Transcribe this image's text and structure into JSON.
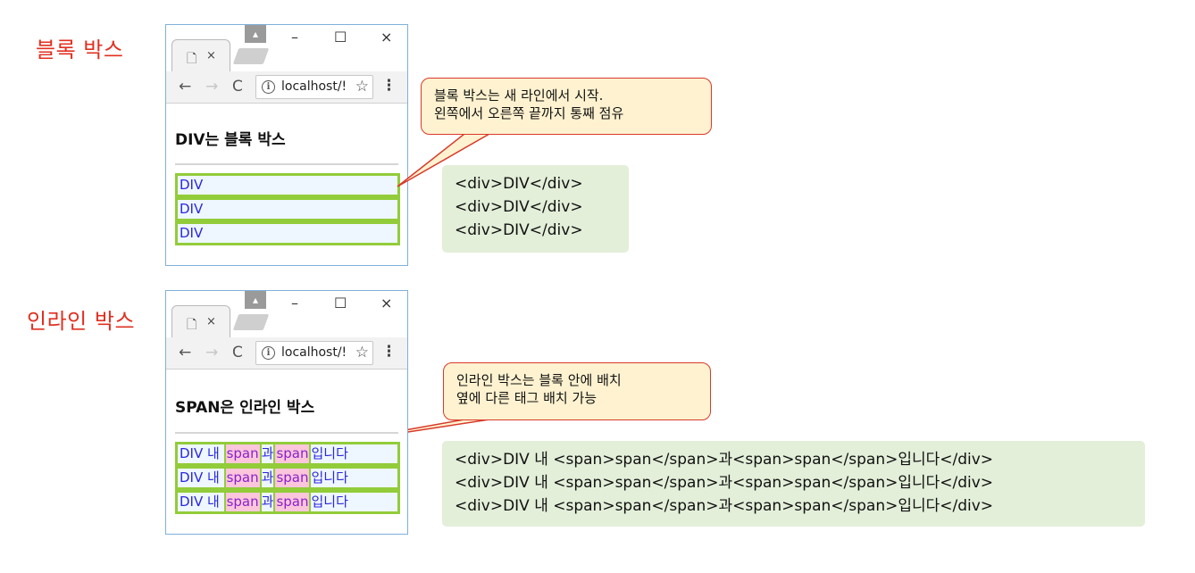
{
  "sections": [
    {
      "label": "블록 박스",
      "browser": {
        "tab_doc_icon": "document-icon",
        "tab_close": "×",
        "win_min": "–",
        "win_max": "☐",
        "win_close": "×",
        "url": "localhost/!",
        "heading": "DIV는 블록 박스",
        "rows": [
          "DIV",
          "DIV",
          "DIV"
        ]
      },
      "callout": [
        "블록 박스는 새 라인에서 시작.",
        "왼쪽에서 오른쪽 끝까지 통째 점유"
      ],
      "code": [
        "<div>DIV</div>",
        "<div>DIV</div>",
        "<div>DIV</div>"
      ]
    },
    {
      "label": "인라인 박스",
      "browser": {
        "tab_doc_icon": "document-icon",
        "tab_close": "×",
        "win_min": "–",
        "win_max": "☐",
        "win_close": "×",
        "url": "localhost/!",
        "heading": "SPAN은 인라인 박스",
        "rows": [
          {
            "pre": "DIV 내 ",
            "span1": "span",
            "mid": "과",
            "span2": "span",
            "post": "입니다"
          },
          {
            "pre": "DIV 내 ",
            "span1": "span",
            "mid": "과",
            "span2": "span",
            "post": "입니다"
          },
          {
            "pre": "DIV 내 ",
            "span1": "span",
            "mid": "과",
            "span2": "span",
            "post": "입니다"
          }
        ]
      },
      "callout": [
        "인라인 박스는 블록 안에 배치",
        "옆에 다른 태그 배치 가능"
      ],
      "code": [
        "<div>DIV 내 <span>span</span>과<span>span</span>입니다</div>",
        "<div>DIV 내 <span>span</span>과<span>span</span>입니다</div>",
        "<div>DIV 내 <span>span</span>과<span>span</span>입니다</div>"
      ]
    }
  ],
  "colors": {
    "label": "#e03020",
    "callout_border": "#d83a2a",
    "callout_fill": "#fff2d0",
    "code_fill": "#e3efd9",
    "div_border": "#92cc3a",
    "div_text": "#2b27e0",
    "span_fill": "#fbc5dc"
  }
}
